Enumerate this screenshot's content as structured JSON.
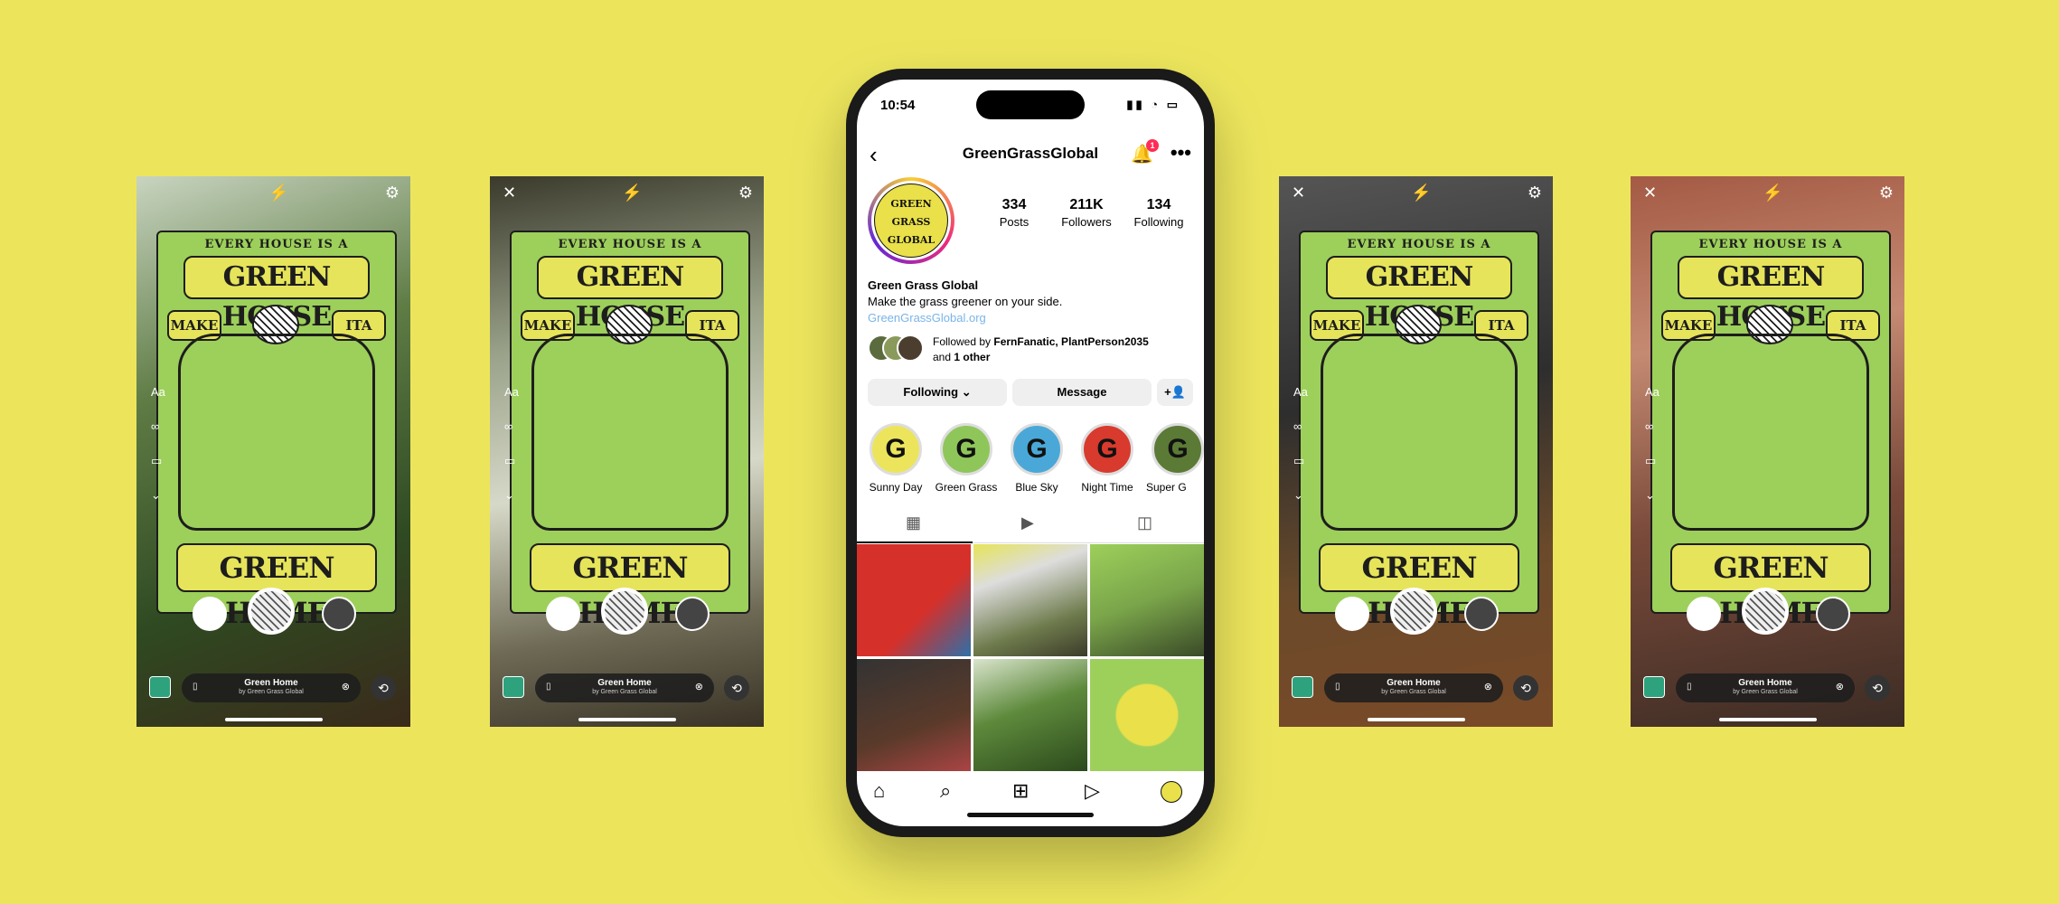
{
  "poster": {
    "arc_text": "EVERY HOUSE IS A",
    "top_banner": "GREEN HOUSE",
    "left_tag": "MAKE",
    "right_tag": "ITA",
    "bottom_banner": "GREEN HOME"
  },
  "story": {
    "text_tool": "Aa",
    "music_title": "Green Home",
    "music_artist": "by Green Grass Global"
  },
  "phone": {
    "status_time": "10:54",
    "username": "GreenGrassGlobal",
    "notification_count": "1",
    "avatar_text": "GREEN GRASS GLOBAL",
    "stats": [
      {
        "value": "334",
        "label": "Posts"
      },
      {
        "value": "211K",
        "label": "Followers"
      },
      {
        "value": "134",
        "label": "Following"
      }
    ],
    "bio": {
      "name": "Green Grass Global",
      "tagline": "Make the grass greener on your side.",
      "link": "GreenGrassGlobal.org"
    },
    "followed_by": {
      "prefix": "Followed by ",
      "names": "FernFanatic, PlantPerson2035",
      "and": "and ",
      "others": "1 other"
    },
    "buttons": {
      "following": "Following",
      "message": "Message"
    },
    "highlights": [
      {
        "label": "Sunny Day",
        "color": "#ece55c"
      },
      {
        "label": "Green Grass",
        "color": "#8fc65a"
      },
      {
        "label": "Blue Sky",
        "color": "#4aa8d8"
      },
      {
        "label": "Night Time",
        "color": "#d83a2e"
      },
      {
        "label": "Super G",
        "color": "#5b7a36"
      }
    ],
    "colors": {
      "accent": "#ece55c",
      "link": "#7ab4e8",
      "badge": "#ff2d55"
    }
  }
}
